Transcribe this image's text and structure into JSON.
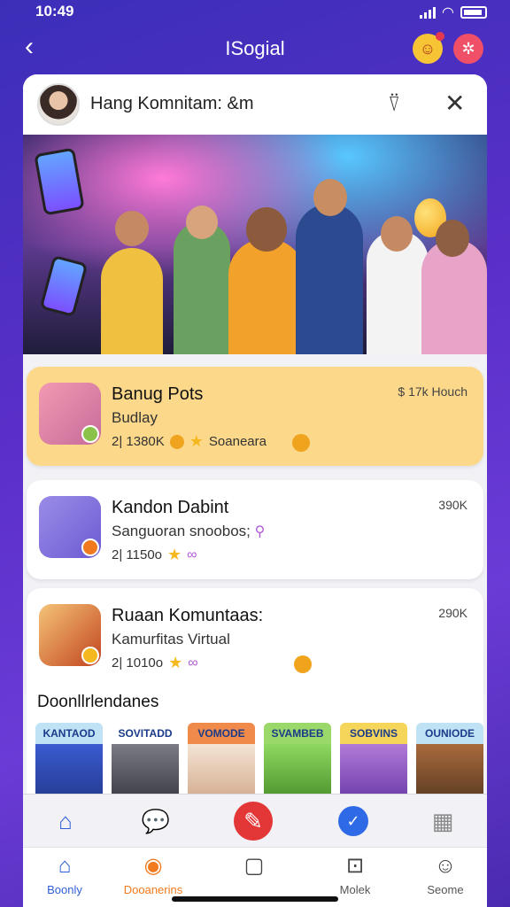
{
  "status": {
    "time": "10:49"
  },
  "nav": {
    "title": "ISogial"
  },
  "header": {
    "title": "Hang Komnitam: &m"
  },
  "cards": [
    {
      "title": "Banug Pots",
      "subtitle": "Budlay",
      "meta": "2| 1380K",
      "meta_extra": "Soaneara",
      "right": "$ 17k Houch"
    },
    {
      "title": "Kandon Dabint",
      "subtitle": "Sanguoran snoobos;",
      "meta": "2| 1150o",
      "meta_extra": "",
      "right": "390K"
    },
    {
      "title": "Ruaan Komuntaas:",
      "subtitle": "Kamurfitas Virtual",
      "meta": "2| 1010o",
      "meta_extra": "",
      "right": "290K"
    }
  ],
  "section": {
    "title": "Doonllrlendanes"
  },
  "recommendations": [
    {
      "label": "KANTAOD",
      "color": "#bfe3f5"
    },
    {
      "label": "SOVITADD",
      "color": "#ffffff"
    },
    {
      "label": "VOMODE",
      "color": "#f08a4b"
    },
    {
      "label": "SVAMBEB",
      "color": "#9bd86a"
    },
    {
      "label": "SOBVINS",
      "color": "#f5d65a"
    },
    {
      "label": "OUNIODE",
      "color": "#bfe3f5"
    }
  ],
  "tabs": [
    {
      "label": "Boonly",
      "icon": "home-icon"
    },
    {
      "label": "Dooanerins",
      "icon": "profile-badge-icon"
    },
    {
      "label": "",
      "icon": "square-icon"
    },
    {
      "label": "Molek",
      "icon": "chat-square-icon"
    },
    {
      "label": "Seome",
      "icon": "person-icon"
    }
  ],
  "colors": {
    "accent": "#2f5fd6",
    "highlight_card": "#fcd88a",
    "fab": "#e33636",
    "background": "#5a2fc9"
  }
}
